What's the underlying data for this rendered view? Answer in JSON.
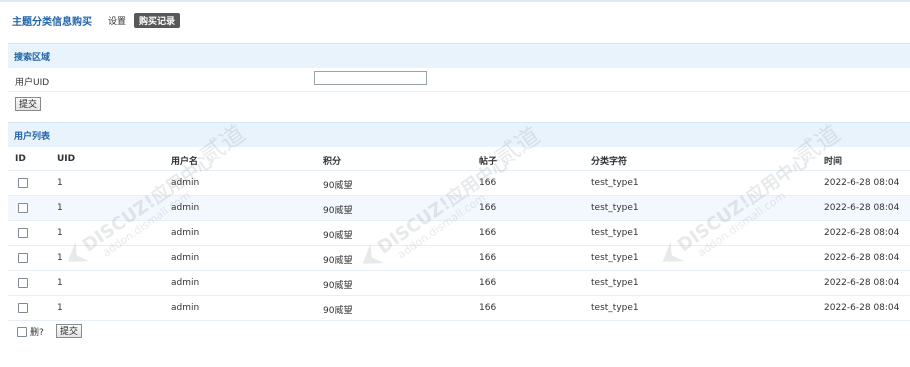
{
  "header": {
    "title": "主题分类信息购买",
    "tabs": [
      {
        "label": "设置",
        "active": false
      },
      {
        "label": "购买记录",
        "active": true
      }
    ]
  },
  "search": {
    "section_title": "搜索区域",
    "uid_label": "用户UID",
    "uid_value": "",
    "submit_label": "提交"
  },
  "user_list": {
    "section_title": "用户列表",
    "columns": [
      "ID",
      "UID",
      "用户名",
      "积分",
      "帖子",
      "分类字符",
      "时间"
    ],
    "rows": [
      {
        "uid": "1",
        "username": "admin",
        "score": "90威望",
        "posts": "166",
        "type": "test_type1",
        "time": "2022-6-28 08:04"
      },
      {
        "uid": "1",
        "username": "admin",
        "score": "90威望",
        "posts": "166",
        "type": "test_type1",
        "time": "2022-6-28 08:04"
      },
      {
        "uid": "1",
        "username": "admin",
        "score": "90威望",
        "posts": "166",
        "type": "test_type1",
        "time": "2022-6-28 08:04"
      },
      {
        "uid": "1",
        "username": "admin",
        "score": "90威望",
        "posts": "166",
        "type": "test_type1",
        "time": "2022-6-28 08:04"
      },
      {
        "uid": "1",
        "username": "admin",
        "score": "90威望",
        "posts": "166",
        "type": "test_type1",
        "time": "2022-6-28 08:04"
      },
      {
        "uid": "1",
        "username": "admin",
        "score": "90威望",
        "posts": "166",
        "type": "test_type1",
        "time": "2022-6-28 08:04"
      }
    ],
    "highlight_row_index": 1,
    "delete_label": "删?",
    "submit_label": "提交"
  },
  "watermark": {
    "brand_text": "DISCUZ!应用中心",
    "url_text": "addon.dismall.com",
    "side_text": "贰道"
  },
  "colors": {
    "accent": "#2366a8",
    "section_bg": "#e9f3fb",
    "active_tab_bg": "#585858",
    "row_highlight": "#f2f8fd"
  }
}
